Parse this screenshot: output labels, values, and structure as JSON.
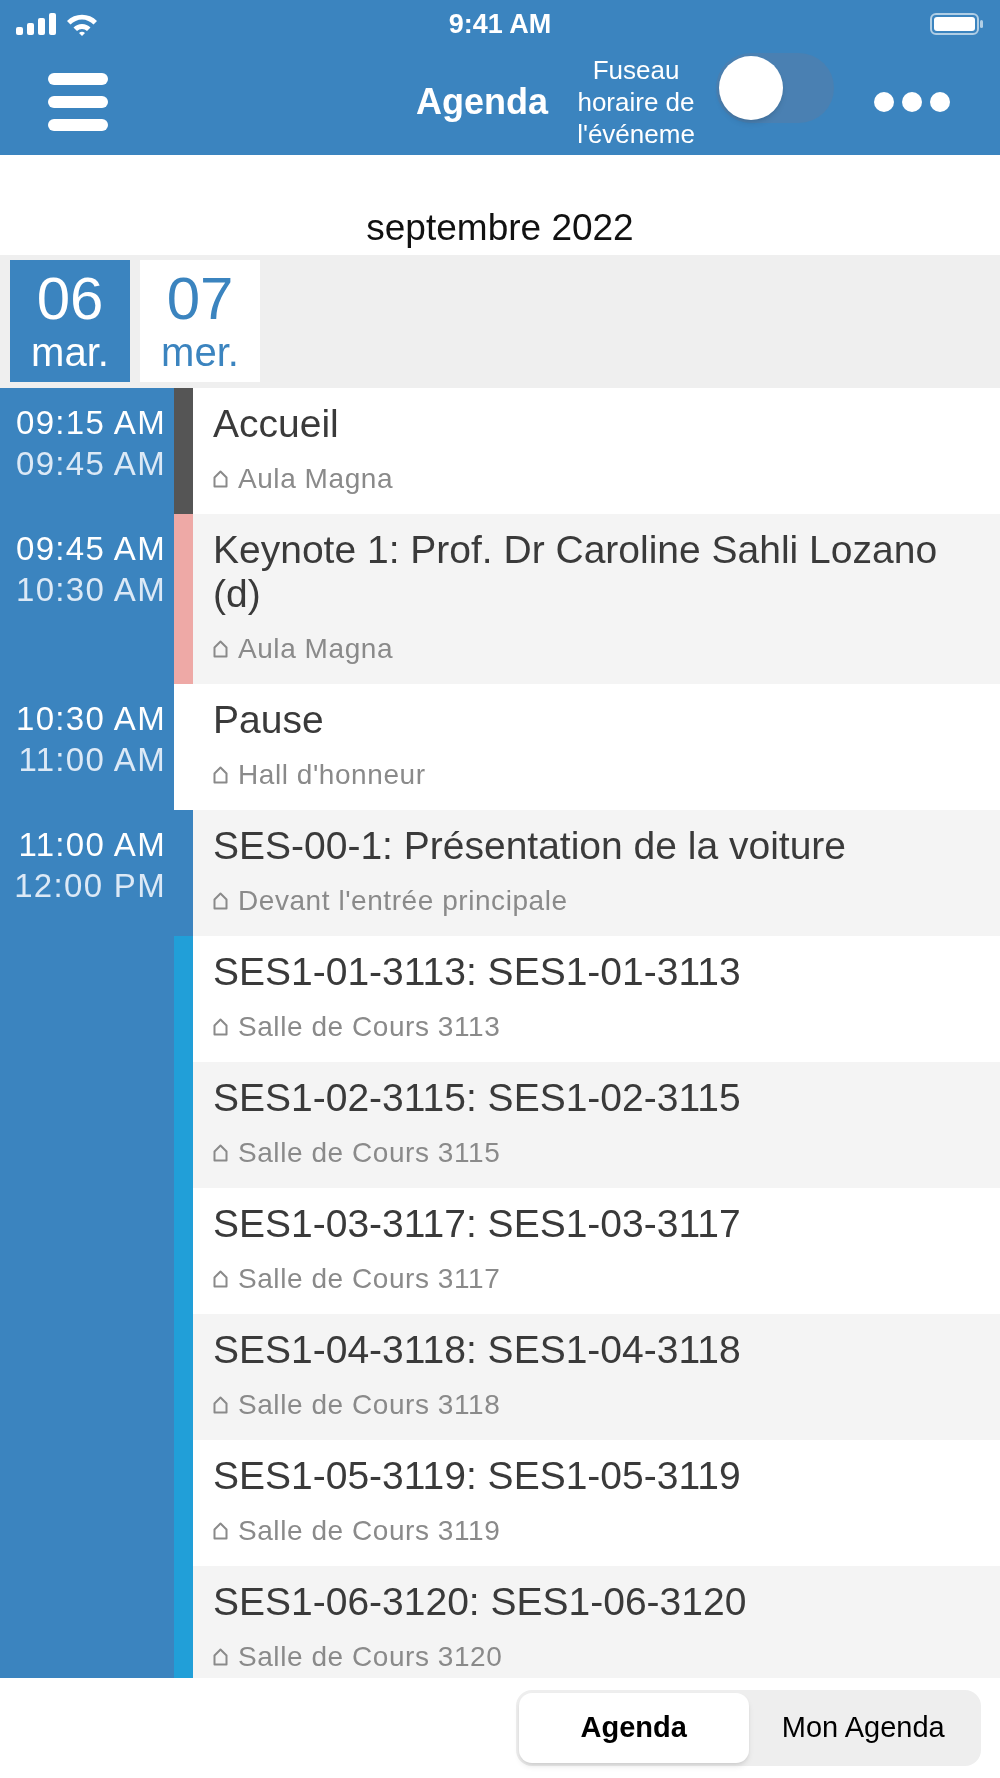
{
  "status_bar": {
    "time": "9:41 AM"
  },
  "header": {
    "title": "Agenda",
    "timezone_toggle": {
      "label": "Fuseau horaire de l'événeme",
      "on": false
    }
  },
  "month": "septembre 2022",
  "days": [
    {
      "number": "06",
      "weekday": "mar.",
      "selected": true
    },
    {
      "number": "07",
      "weekday": "mer.",
      "selected": false
    }
  ],
  "events": [
    {
      "start": "09:15 AM",
      "end": "09:45 AM",
      "title": "Accueil",
      "location": "Aula Magna",
      "color": "#555555"
    },
    {
      "start": "09:45 AM",
      "end": "10:30 AM",
      "title": "Keynote 1: Prof. Dr Caroline Sahli Lozano (d)",
      "location": "Aula Magna",
      "color": "#eea9a6"
    },
    {
      "start": "10:30 AM",
      "end": "11:00 AM",
      "title": "Pause",
      "location": "Hall d'honneur"
    },
    {
      "start": "11:00 AM",
      "end": "12:00 PM",
      "title": "SES-00-1: Présentation de la voiture",
      "location": "Devant l'entrée principale",
      "color": "#3b84bf"
    },
    {
      "title": "SES1-01-3113: SES1-01-3113",
      "location": "Salle de Cours 3113",
      "color": "#219fd8"
    },
    {
      "title": "SES1-02-3115: SES1-02-3115",
      "location": "Salle de Cours 3115",
      "color": "#219fd8"
    },
    {
      "title": "SES1-03-3117: SES1-03-3117",
      "location": "Salle de Cours 3117",
      "color": "#219fd8"
    },
    {
      "title": "SES1-04-3118: SES1-04-3118",
      "location": "Salle de Cours 3118",
      "color": "#219fd8"
    },
    {
      "title": "SES1-05-3119: SES1-05-3119",
      "location": "Salle de Cours 3119",
      "color": "#219fd8"
    },
    {
      "title": "SES1-06-3120: SES1-06-3120",
      "location": "Salle de Cours 3120",
      "color": "#219fd8"
    }
  ],
  "view_switcher": [
    {
      "label": "Agenda",
      "selected": true
    },
    {
      "label": "Mon Agenda",
      "selected": false
    }
  ]
}
